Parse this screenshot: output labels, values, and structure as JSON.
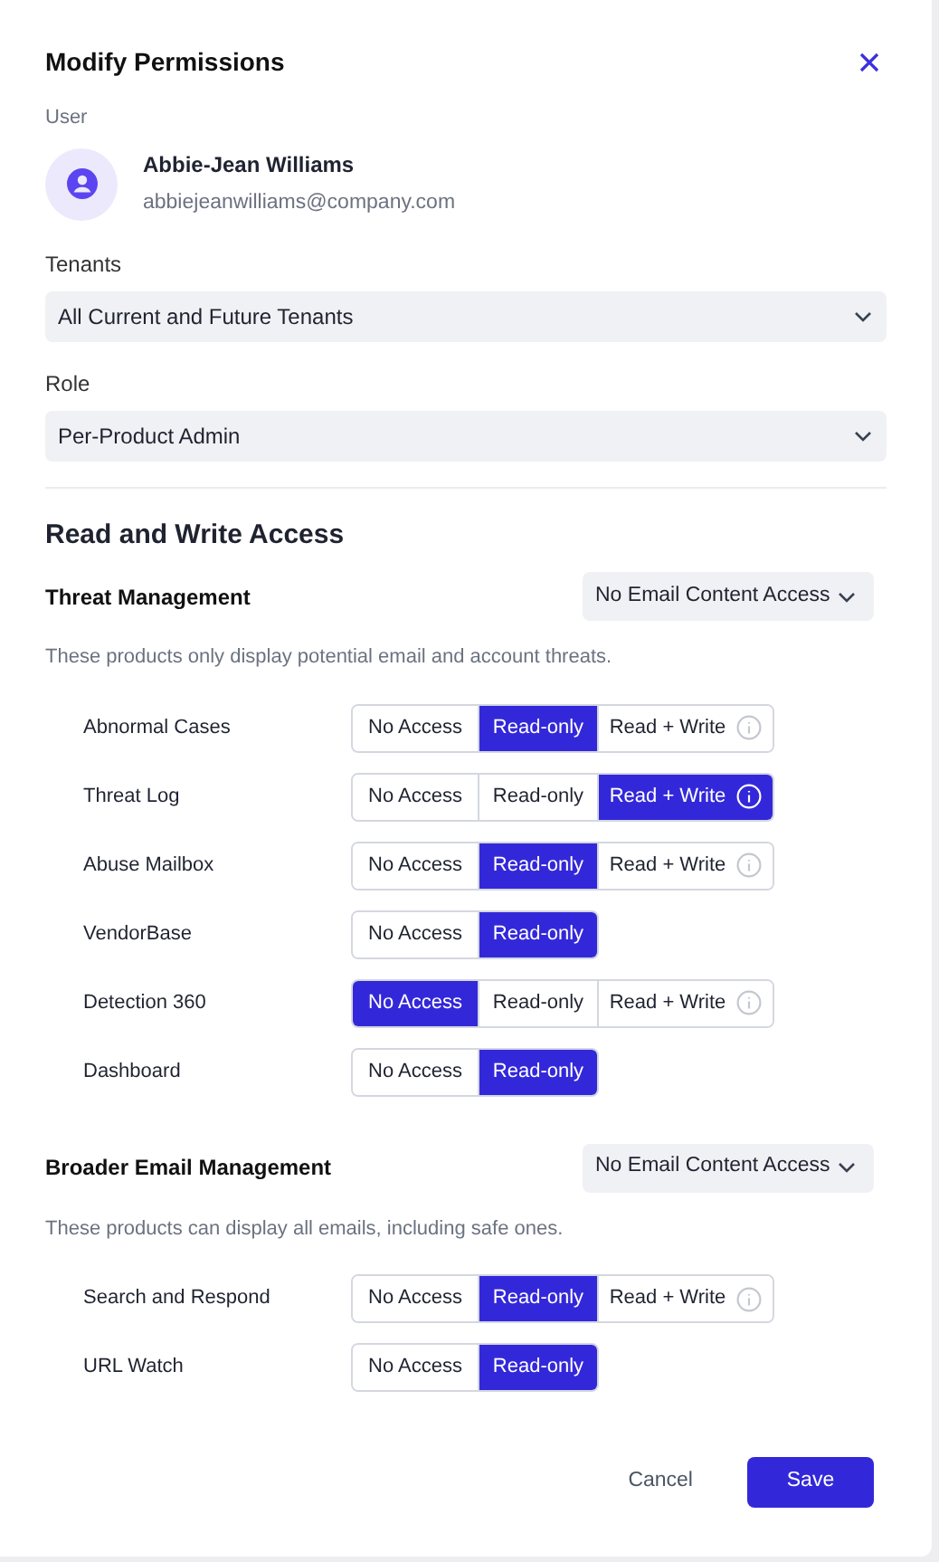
{
  "dialog": {
    "title": "Modify Permissions"
  },
  "user": {
    "label": "User",
    "name": "Abbie-Jean Williams",
    "email": "abbiejeanwilliams@company.com"
  },
  "tenants": {
    "label": "Tenants",
    "value": "All Current and Future Tenants"
  },
  "role": {
    "label": "Role",
    "value": "Per-Product Admin"
  },
  "access_title": "Read and Write Access",
  "groups": [
    {
      "title": "Threat Management",
      "dropdown": "No Email Content Access",
      "description": "These products only display potential email and account threats.",
      "products": [
        {
          "name": "Abnormal Cases",
          "options": [
            {
              "label": "No Access",
              "selected": false,
              "info": false
            },
            {
              "label": "Read-only",
              "selected": true,
              "info": false
            },
            {
              "label": "Read + Write",
              "selected": false,
              "info": true
            }
          ]
        },
        {
          "name": "Threat Log",
          "options": [
            {
              "label": "No Access",
              "selected": false,
              "info": false
            },
            {
              "label": "Read-only",
              "selected": false,
              "info": false
            },
            {
              "label": "Read + Write",
              "selected": true,
              "info": true
            }
          ]
        },
        {
          "name": "Abuse Mailbox",
          "options": [
            {
              "label": "No Access",
              "selected": false,
              "info": false
            },
            {
              "label": "Read-only",
              "selected": true,
              "info": false
            },
            {
              "label": "Read + Write",
              "selected": false,
              "info": true
            }
          ]
        },
        {
          "name": "VendorBase",
          "options": [
            {
              "label": "No Access",
              "selected": false,
              "info": false
            },
            {
              "label": "Read-only",
              "selected": true,
              "info": false
            }
          ]
        },
        {
          "name": "Detection 360",
          "options": [
            {
              "label": "No Access",
              "selected": true,
              "info": false
            },
            {
              "label": "Read-only",
              "selected": false,
              "info": false
            },
            {
              "label": "Read + Write",
              "selected": false,
              "info": true
            }
          ]
        },
        {
          "name": "Dashboard",
          "options": [
            {
              "label": "No Access",
              "selected": false,
              "info": false
            },
            {
              "label": "Read-only",
              "selected": true,
              "info": false
            }
          ]
        }
      ]
    },
    {
      "title": "Broader Email Management",
      "dropdown": "No Email Content Access",
      "description": "These products can display all emails, including safe ones.",
      "products": [
        {
          "name": "Search and Respond",
          "options": [
            {
              "label": "No Access",
              "selected": false,
              "info": false
            },
            {
              "label": "Read-only",
              "selected": true,
              "info": false
            },
            {
              "label": "Read + Write",
              "selected": false,
              "info": true
            }
          ]
        },
        {
          "name": "URL Watch",
          "options": [
            {
              "label": "No Access",
              "selected": false,
              "info": false
            },
            {
              "label": "Read-only",
              "selected": true,
              "info": false
            }
          ]
        }
      ]
    }
  ],
  "buttons": {
    "cancel": "Cancel",
    "save": "Save"
  }
}
